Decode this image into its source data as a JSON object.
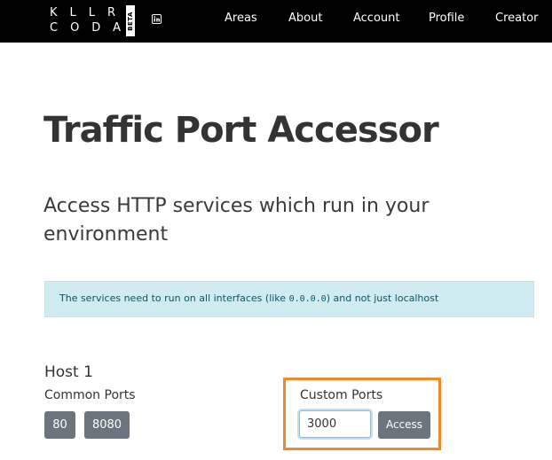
{
  "navbar": {
    "logo_top": "KLLR",
    "logo_bottom": "CODA",
    "logo_badge": "BETA",
    "social_icon": "linkedin-icon",
    "items": [
      "Areas",
      "About",
      "Account",
      "Profile",
      "Creator"
    ]
  },
  "page": {
    "title": "Traffic Port Accessor",
    "subtitle": "Access HTTP services which run in your environment"
  },
  "info": {
    "text_before": "The services need to run on all interfaces (like ",
    "code": "0.0.0.0",
    "text_after": ") and not just localhost"
  },
  "host": {
    "title": "Host 1",
    "common_label": "Common Ports",
    "common_ports": [
      "80",
      "8080"
    ],
    "custom_label": "Custom Ports",
    "custom_value": "3000",
    "access_label": "Access"
  },
  "colors": {
    "navbar_bg": "#000000",
    "info_bg": "#d1ecf1",
    "button_bg": "#6c757d",
    "highlight_border": "#f0882e"
  }
}
